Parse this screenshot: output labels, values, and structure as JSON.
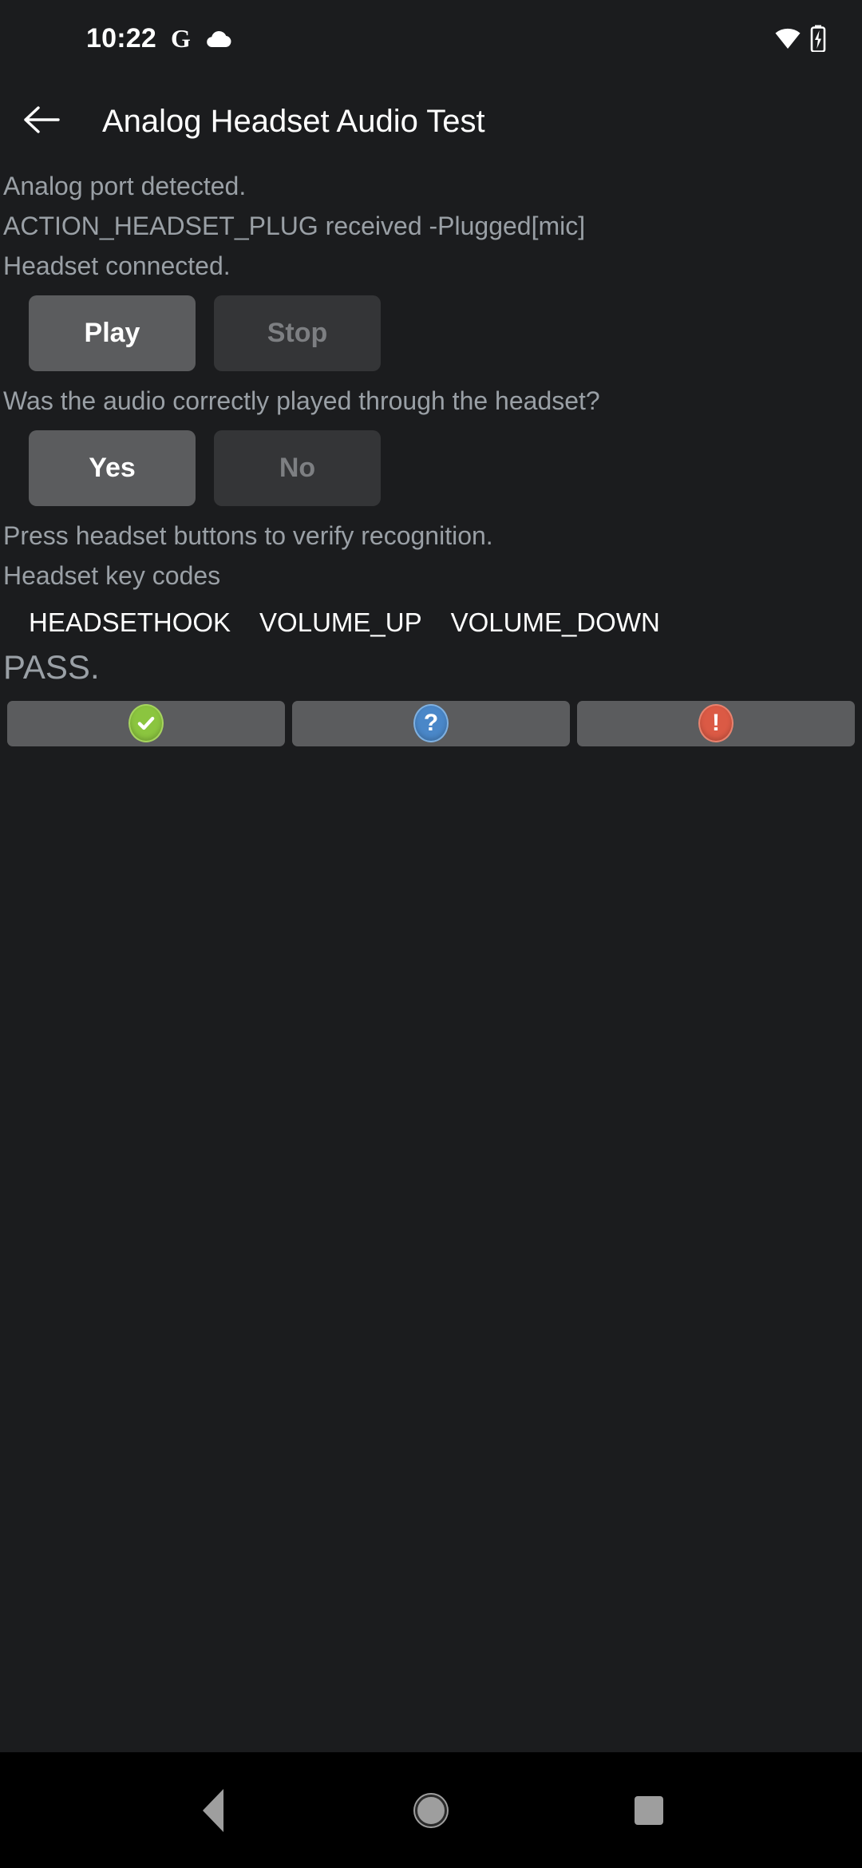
{
  "status_bar": {
    "time": "10:22",
    "google_icon_glyph": "G",
    "icons": [
      "google-icon",
      "cloud-icon",
      "wifi-icon",
      "battery-charging-icon"
    ]
  },
  "app_bar": {
    "back_label": "back-arrow",
    "title": "Analog Headset Audio Test"
  },
  "main": {
    "log_lines": [
      "Analog port detected.",
      "ACTION_HEADSET_PLUG received -Plugged[mic]",
      "Headset connected."
    ],
    "playback": {
      "play_label": "Play",
      "play_enabled": true,
      "stop_label": "Stop",
      "stop_enabled": false
    },
    "question": "Was the audio correctly played through the headset?",
    "answer": {
      "yes_label": "Yes",
      "yes_enabled": true,
      "no_label": "No",
      "no_enabled": false
    },
    "instruction": "Press headset buttons to verify recognition.",
    "keycodes_label": "Headset key codes",
    "keycodes": [
      "HEADSETHOOK",
      "VOLUME_UP",
      "VOLUME_DOWN"
    ],
    "result": "PASS."
  },
  "verdict_bar": {
    "pass_icon": "check-circle-icon",
    "info_icon": "question-circle-icon",
    "fail_icon": "exclamation-circle-icon",
    "info_glyph": "?",
    "fail_glyph": "!"
  },
  "nav_bar": {
    "back": "nav-back-icon",
    "home": "nav-home-icon",
    "recents": "nav-recents-icon"
  },
  "colors": {
    "background": "#1b1c1e",
    "button_enabled": "#5b5c5e",
    "button_disabled": "#343537",
    "body_text": "#9aa0a6",
    "pass_green": "#8bc53f",
    "info_blue": "#4a87c8",
    "fail_red": "#db5a45",
    "nav_bar": "#000000"
  }
}
